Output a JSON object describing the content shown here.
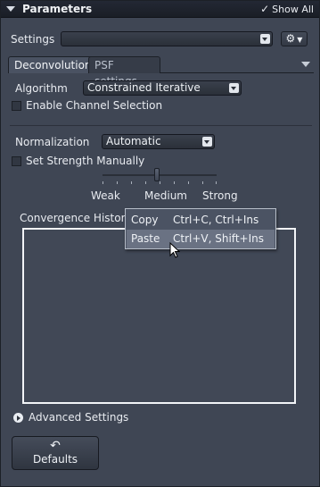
{
  "titlebar": {
    "title": "Parameters",
    "show_all": "Show All",
    "show_all_checked": true
  },
  "settings": {
    "label": "Settings",
    "value": "",
    "gear_label": "⚙"
  },
  "tabs": [
    {
      "label": "Deconvolution",
      "active": true
    },
    {
      "label": "PSF settings",
      "active": false
    }
  ],
  "algorithm": {
    "label": "Algorithm",
    "value": "Constrained Iterative"
  },
  "enable_channel_selection": {
    "label": "Enable Channel Selection",
    "checked": false
  },
  "normalization": {
    "label": "Normalization",
    "value": "Automatic"
  },
  "set_strength": {
    "label": "Set Strength Manually",
    "checked": false
  },
  "strength_slider": {
    "labels": [
      "Weak",
      "Medium",
      "Strong"
    ],
    "value": "Medium"
  },
  "convergence_history": {
    "label": "Convergence History"
  },
  "context_menu": {
    "items": [
      {
        "label": "Copy",
        "shortcut": "Ctrl+C, Ctrl+Ins",
        "hovered": false
      },
      {
        "label": "Paste",
        "shortcut": "Ctrl+V, Shift+Ins",
        "hovered": true
      }
    ]
  },
  "advanced_settings": {
    "label": "Advanced Settings"
  },
  "defaults_button": {
    "label": "Defaults",
    "icon": "↶"
  },
  "colors": {
    "panel_bg": "#3f4654",
    "highlight": "#6a7283",
    "titlebar_bg": "#1e222b"
  }
}
